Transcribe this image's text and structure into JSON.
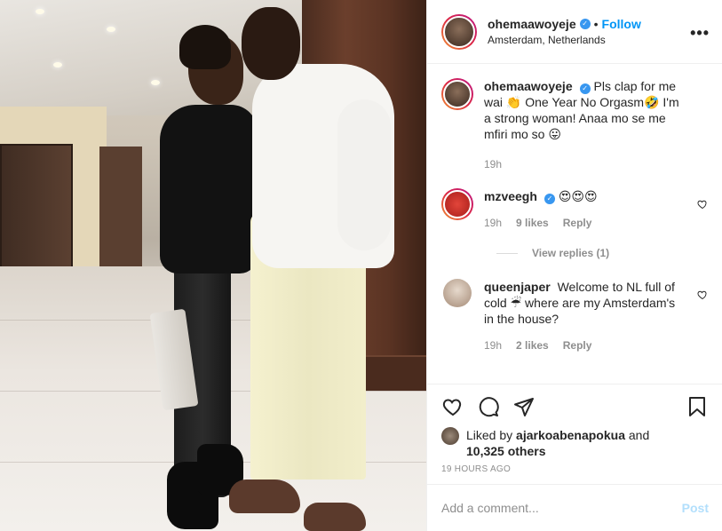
{
  "post_author": {
    "username": "ohemaawoyeje",
    "location": "Amsterdam, Netherlands",
    "follow_label": "Follow",
    "separator": "•",
    "verified": true
  },
  "more_label": "•••",
  "caption": {
    "username": "ohemaawoyeje",
    "text": "Pls clap for me wai 👏 One Year No Orgasm🤣 I'm a strong woman! Anaa mo se me mfiri mo so 😛",
    "time": "19h"
  },
  "comments": [
    {
      "username": "mzveegh",
      "text": "😍😍😍",
      "time": "19h",
      "likes": "9 likes",
      "reply_label": "Reply",
      "view_replies": "View replies (1)",
      "avatar_color": "#d9372c"
    },
    {
      "username": "queenjaper",
      "text": "Welcome to NL full of cold ☔ where are my Amsterdam's in the house?",
      "time": "19h",
      "likes": "2 likes",
      "reply_label": "Reply",
      "avatar_color": "#c9b6a6"
    }
  ],
  "liked_by": {
    "prefix": "Liked by",
    "user": "ajarkoabenapokua",
    "conj": "and",
    "others": "10,325 others"
  },
  "timestamp": "19 HOURS AGO",
  "add_comment": {
    "placeholder": "Add a comment...",
    "post_label": "Post"
  },
  "colors": {
    "accent": "#0095f6",
    "verified": "#3897f0",
    "muted": "#8e8e8e",
    "post_disabled": "#b2dffc"
  }
}
